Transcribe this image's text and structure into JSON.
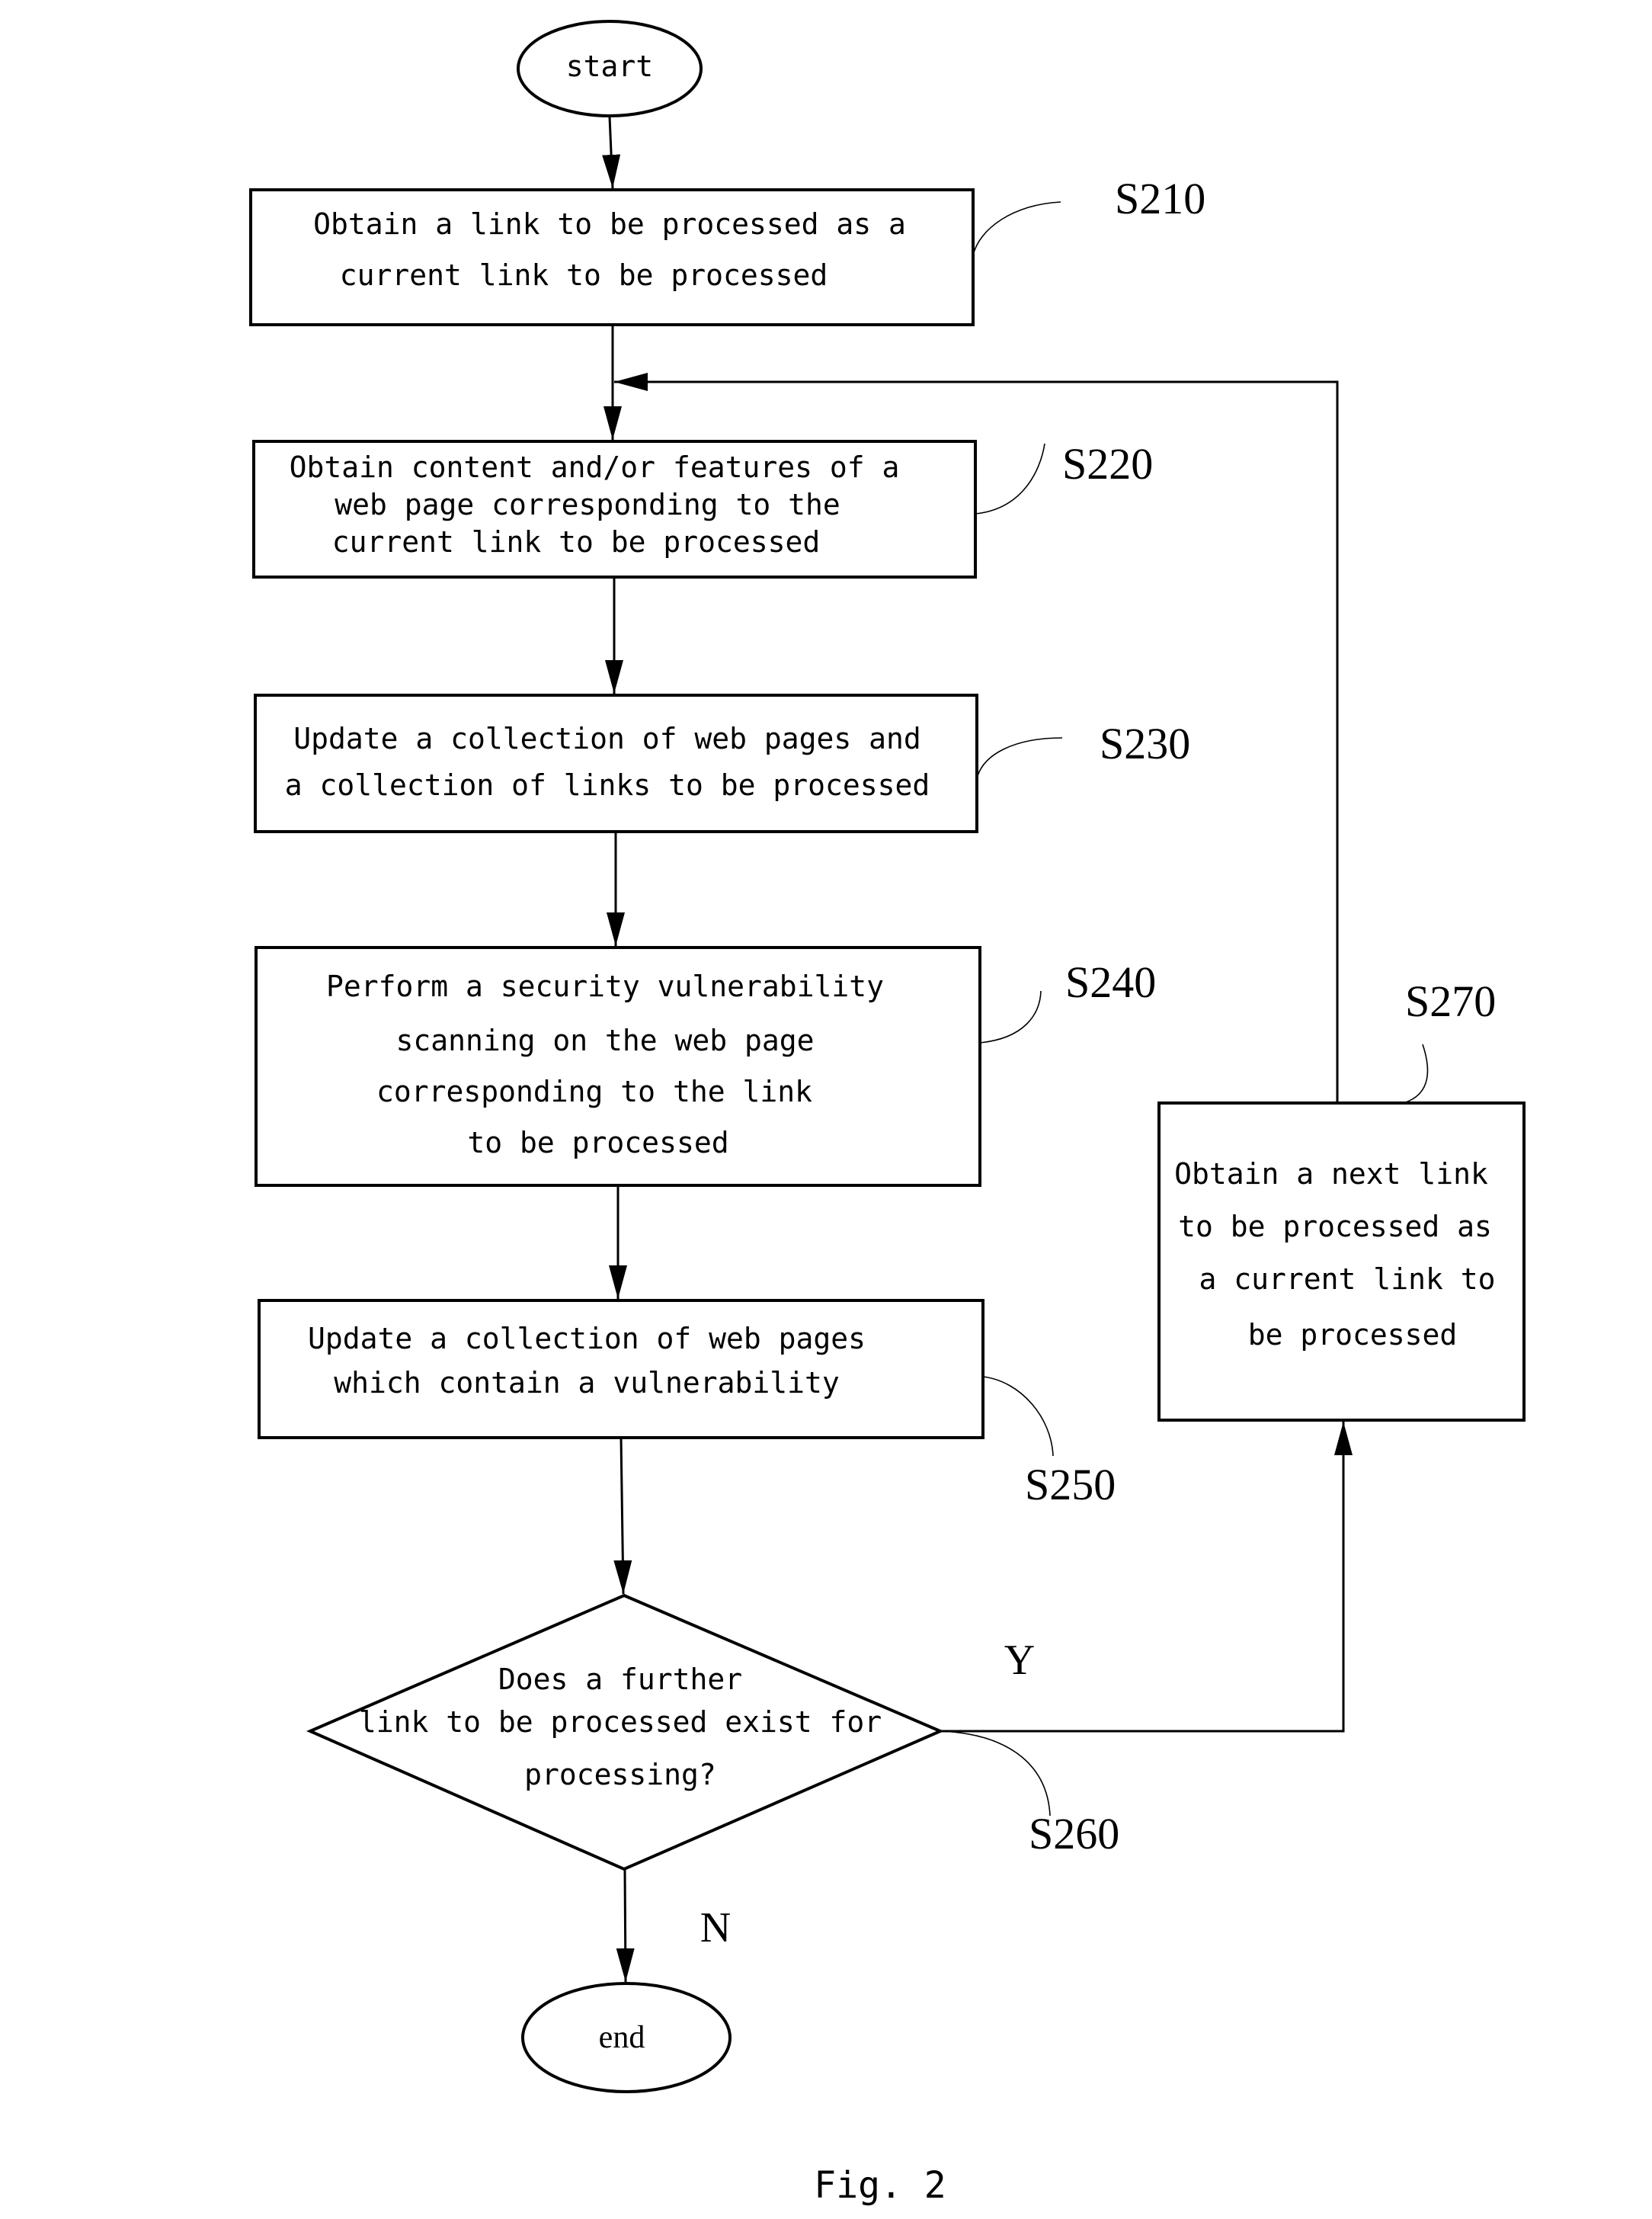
{
  "diagram": {
    "type": "flowchart",
    "caption": "Fig. 2",
    "start": {
      "label": "start"
    },
    "end": {
      "label": "end"
    },
    "steps": [
      {
        "id": "S210",
        "lines": [
          "Obtain a link to be processed as a",
          "current link to be processed"
        ]
      },
      {
        "id": "S220",
        "lines": [
          "Obtain content and/or features of a",
          "web page corresponding to the",
          "current link to be processed"
        ]
      },
      {
        "id": "S230",
        "lines": [
          "Update a collection of web pages and",
          "a collection of links to be processed"
        ]
      },
      {
        "id": "S240",
        "lines": [
          "Perform a security vulnerability",
          "scanning on the web page",
          "corresponding to the link",
          "to be processed"
        ]
      },
      {
        "id": "S250",
        "lines": [
          "Update a collection of web pages",
          "which contain a vulnerability"
        ]
      },
      {
        "id": "S270",
        "lines": [
          "Obtain a next link",
          "to be processed as",
          "a current link to",
          "be processed"
        ]
      }
    ],
    "decision": {
      "id": "S260",
      "lines": [
        "Does a further",
        "link to be processed exist for",
        "processing?"
      ],
      "yes_label": "Y",
      "no_label": "N"
    }
  }
}
